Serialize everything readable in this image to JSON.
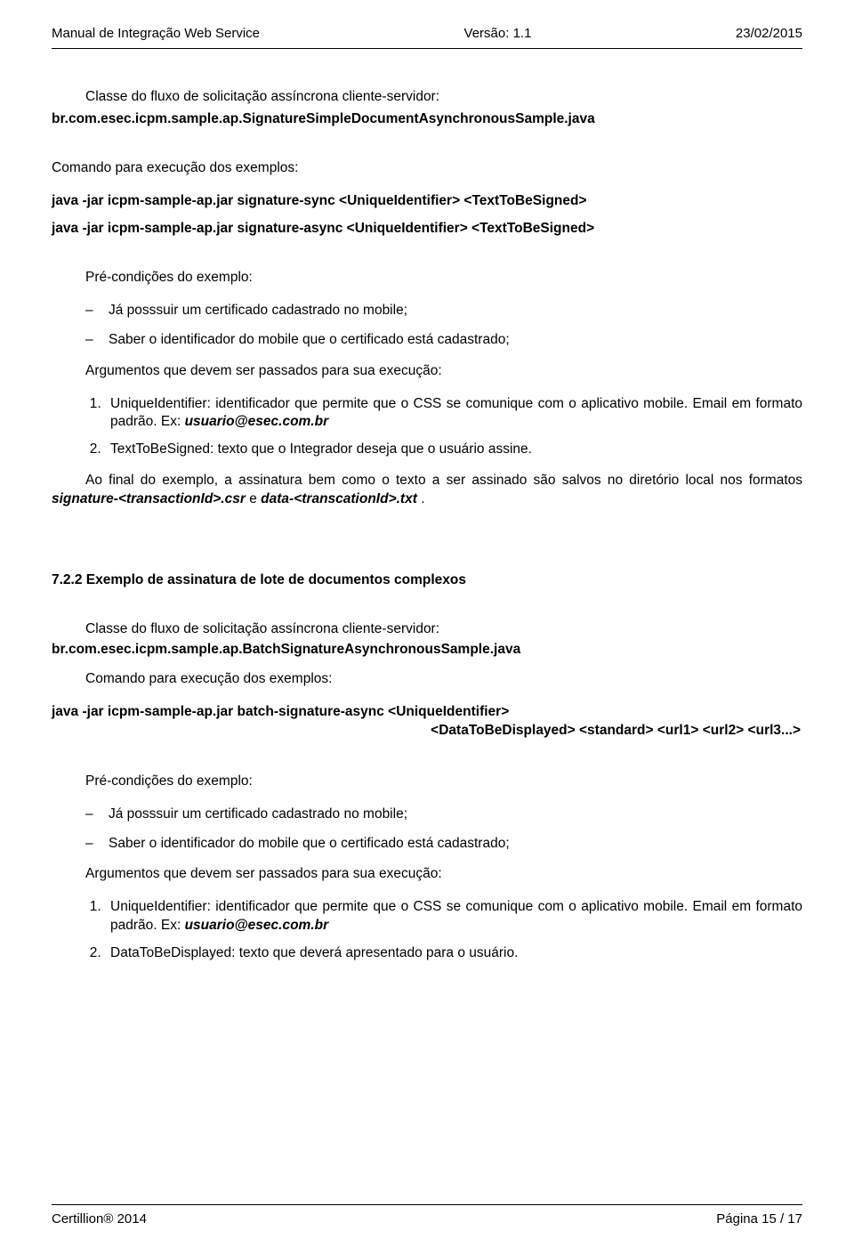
{
  "header": {
    "left": "Manual de Integração Web Service",
    "center": "Versão: 1.1",
    "right": "23/02/2015"
  },
  "footer": {
    "left": "Certillion® 2014",
    "right": "Página 15 / 17"
  },
  "classe1_intro": "Classe do fluxo de solicitação assíncrona cliente-servidor:",
  "classe1_name": "br.com.esec.icpm.sample.ap.SignatureSimpleDocumentAsynchronousSample.java",
  "cmd_heading": "Comando para execução dos exemplos:",
  "cmd1_line1": "java -jar icpm-sample-ap.jar signature-sync <UniqueIdentifier> <TextToBeSigned>",
  "cmd1_line2": "java -jar icpm-sample-ap.jar signature-async <UniqueIdentifier> <TextToBeSigned>",
  "pre_heading": "Pré-condições do exemplo:",
  "pre_items": {
    "a": "Já posssuir um certificado cadastrado no mobile;",
    "b": "Saber o identificador do mobile que o certificado está cadastrado;"
  },
  "args_heading": "Argumentos que devem ser passados para sua execução:",
  "arg1_a": "UniqueIdentifier: identificador que permite que o CSS se comunique com o aplicativo mobile. Email em formato padrão. Ex: ",
  "arg1_b": "usuario@esec.com.br",
  "arg2": "TextToBeSigned: texto que o Integrador deseja que o usuário assine.",
  "final1_a": "Ao final do exemplo, a assinatura bem como o texto a ser assinado são salvos no diretório local nos formatos ",
  "final1_b": "signature-<transactionId>.csr",
  "final1_c": " e ",
  "final1_d": "data-<transcationId>.txt",
  "final1_e": " .",
  "section722": "7.2.2 Exemplo de assinatura de lote de documentos complexos",
  "classe2_intro": "Classe do fluxo de solicitação assíncrona cliente-servidor:",
  "classe2_name": "br.com.esec.icpm.sample.ap.BatchSignatureAsynchronousSample.java",
  "cmd2_heading": "Comando para execução dos exemplos:",
  "cmd2_line1": "java -jar icpm-sample-ap.jar batch-signature-async <UniqueIdentifier>",
  "cmd2_line2": "<DataToBeDisplayed> <standard> <url1> <url2> <url3...>",
  "arg2b": "DataToBeDisplayed: texto que deverá apresentado para o usuário."
}
